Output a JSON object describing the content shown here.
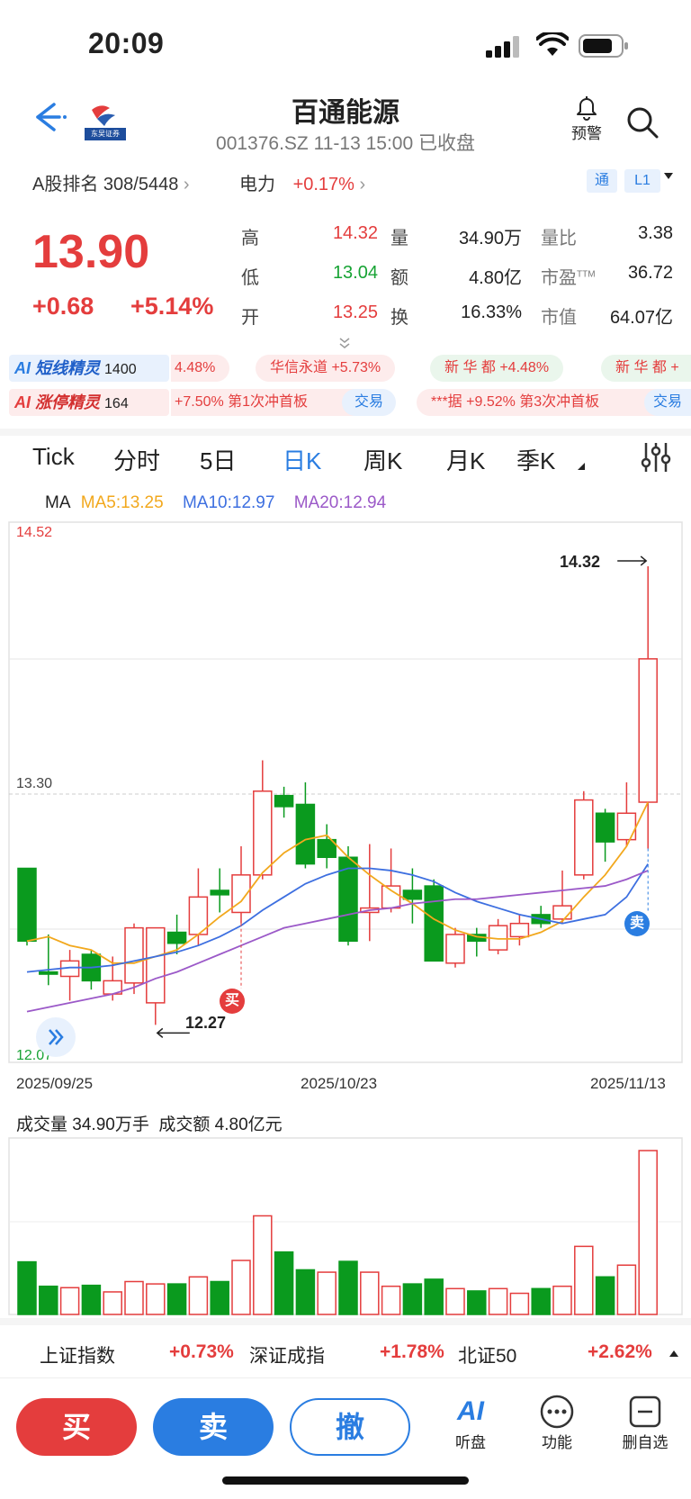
{
  "status_bar": {
    "time": "20:09"
  },
  "header": {
    "stock_name": "百通能源",
    "subtitle": "001376.SZ 11-13 15:00 已收盘",
    "logo_text": "东吴证券",
    "alert_label": "预警"
  },
  "rank": {
    "label": "A股排名 308/5448",
    "sector_name": "电力",
    "sector_change": "+0.17%",
    "tag1": "通",
    "tag2": "L1"
  },
  "quote": {
    "price": "13.90",
    "change": "+0.68",
    "change_pct": "+5.14%",
    "more_icon": "chevron-double-down-icon",
    "fields": [
      {
        "label": "高",
        "value": "14.32"
      },
      {
        "label": "低",
        "value": "13.04"
      },
      {
        "label": "开",
        "value": "13.25"
      },
      {
        "label": "量",
        "value": "34.90万"
      },
      {
        "label": "额",
        "value": "4.80亿"
      },
      {
        "label": "换",
        "value": "16.33%"
      },
      {
        "label": "量比",
        "value": "3.38"
      },
      {
        "label": "市盈",
        "sup": "TTM",
        "value": "36.72"
      },
      {
        "label": "市值",
        "value": "64.07亿"
      }
    ]
  },
  "ai": {
    "row1": {
      "badge_name": "短线精灵",
      "badge_count": "1400",
      "pills": [
        "4.48%",
        "华信永道 +5.73%",
        "新 华 都 +4.48%",
        "新 华 都 +"
      ]
    },
    "row2": {
      "badge_name": "涨停精灵",
      "badge_count": "164",
      "pills": [
        "+7.50% 第1次冲首板",
        "交易",
        "***据 +9.52% 第3次冲首板",
        "交易"
      ]
    }
  },
  "tabs": [
    "Tick",
    "分时",
    "5日",
    "日K",
    "周K",
    "月K",
    "季K"
  ],
  "active_tab": "日K",
  "ma": {
    "label": "MA",
    "ma5": "MA5:13.25",
    "ma10": "MA10:12.97",
    "ma20": "MA20:12.94"
  },
  "colors": {
    "up": "#e43d3d",
    "down": "#0a9a1e",
    "ma5": "#f2a81d",
    "ma10": "#3d6fe0",
    "ma20": "#9b59c8",
    "accent": "#2a7de1"
  },
  "chart_data": {
    "type": "candlestick",
    "y_top_label": "14.52",
    "y_mid_label": "13.30",
    "y_bottom_label": "12.07",
    "ylim": [
      12.07,
      14.52
    ],
    "x_labels": [
      "2025/09/25",
      "2025/10/23",
      "2025/11/13"
    ],
    "high_marker": "14.32",
    "low_marker": "12.27",
    "buy_marker": "买",
    "sell_marker": "卖",
    "candles": [
      {
        "o": 12.95,
        "c": 12.62,
        "h": 12.95,
        "l": 12.6
      },
      {
        "o": 12.48,
        "c": 12.47,
        "h": 12.65,
        "l": 12.42
      },
      {
        "o": 12.46,
        "c": 12.53,
        "h": 12.58,
        "l": 12.35
      },
      {
        "o": 12.56,
        "c": 12.44,
        "h": 12.58,
        "l": 12.4
      },
      {
        "o": 12.38,
        "c": 12.44,
        "h": 12.55,
        "l": 12.35
      },
      {
        "o": 12.43,
        "c": 12.68,
        "h": 12.7,
        "l": 12.38
      },
      {
        "o": 12.34,
        "c": 12.68,
        "h": 12.68,
        "l": 12.24
      },
      {
        "o": 12.66,
        "c": 12.61,
        "h": 12.74,
        "l": 12.56
      },
      {
        "o": 12.65,
        "c": 12.82,
        "h": 12.95,
        "l": 12.6
      },
      {
        "o": 12.85,
        "c": 12.83,
        "h": 12.95,
        "l": 12.75
      },
      {
        "o": 12.75,
        "c": 12.92,
        "h": 13.05,
        "l": 12.7
      },
      {
        "o": 12.92,
        "c": 13.3,
        "h": 13.44,
        "l": 12.9
      },
      {
        "o": 13.28,
        "c": 13.23,
        "h": 13.32,
        "l": 13.18
      },
      {
        "o": 13.24,
        "c": 12.97,
        "h": 13.34,
        "l": 12.95
      },
      {
        "o": 13.08,
        "c": 13.0,
        "h": 13.15,
        "l": 12.95
      },
      {
        "o": 13.0,
        "c": 12.62,
        "h": 13.05,
        "l": 12.6
      },
      {
        "o": 12.75,
        "c": 12.77,
        "h": 13.06,
        "l": 12.62
      },
      {
        "o": 12.77,
        "c": 12.87,
        "h": 13.04,
        "l": 12.75
      },
      {
        "o": 12.85,
        "c": 12.81,
        "h": 12.95,
        "l": 12.7
      },
      {
        "o": 12.87,
        "c": 12.53,
        "h": 12.9,
        "l": 12.53
      },
      {
        "o": 12.52,
        "c": 12.65,
        "h": 12.68,
        "l": 12.5
      },
      {
        "o": 12.65,
        "c": 12.62,
        "h": 12.68,
        "l": 12.55
      },
      {
        "o": 12.58,
        "c": 12.69,
        "h": 12.72,
        "l": 12.56
      },
      {
        "o": 12.64,
        "c": 12.7,
        "h": 12.74,
        "l": 12.6
      },
      {
        "o": 12.74,
        "c": 12.7,
        "h": 12.78,
        "l": 12.68
      },
      {
        "o": 12.72,
        "c": 12.78,
        "h": 12.94,
        "l": 12.7
      },
      {
        "o": 12.92,
        "c": 13.26,
        "h": 13.3,
        "l": 12.9
      },
      {
        "o": 13.2,
        "c": 13.07,
        "h": 13.22,
        "l": 12.98
      },
      {
        "o": 13.08,
        "c": 13.2,
        "h": 13.34,
        "l": 13.05
      },
      {
        "o": 13.25,
        "c": 13.9,
        "h": 14.32,
        "l": 13.04
      }
    ],
    "ma5": [
      12.62,
      12.64,
      12.6,
      12.58,
      12.52,
      12.52,
      12.55,
      12.58,
      12.65,
      12.73,
      12.8,
      12.93,
      13.02,
      13.08,
      13.1,
      13.0,
      12.92,
      12.85,
      12.79,
      12.72,
      12.67,
      12.64,
      12.63,
      12.63,
      12.66,
      12.71,
      12.82,
      12.92,
      13.05,
      13.25
    ],
    "ma10": [
      12.48,
      12.49,
      12.5,
      12.5,
      12.51,
      12.53,
      12.55,
      12.57,
      12.6,
      12.64,
      12.69,
      12.76,
      12.82,
      12.88,
      12.92,
      12.95,
      12.95,
      12.94,
      12.92,
      12.89,
      12.84,
      12.8,
      12.77,
      12.74,
      12.72,
      12.7,
      12.72,
      12.74,
      12.82,
      12.97
    ],
    "ma20": [
      12.3,
      12.32,
      12.34,
      12.36,
      12.38,
      12.41,
      12.45,
      12.48,
      12.52,
      12.56,
      12.6,
      12.64,
      12.68,
      12.7,
      12.72,
      12.74,
      12.76,
      12.77,
      12.79,
      12.8,
      12.81,
      12.81,
      12.82,
      12.83,
      12.84,
      12.85,
      12.86,
      12.87,
      12.9,
      12.94
    ]
  },
  "volume": {
    "title": "成交量 34.90万手  成交额 4.80亿元",
    "values": [
      11.2,
      6.0,
      5.7,
      6.2,
      4.8,
      7.0,
      6.5,
      6.5,
      8.0,
      7.0,
      11.5,
      21.0,
      13.3,
      9.5,
      9.0,
      11.3,
      9.0,
      6.0,
      6.5,
      7.5,
      5.5,
      5.0,
      5.5,
      4.5,
      5.5,
      6.0,
      14.5,
      8.0,
      10.5,
      34.9
    ],
    "up": [
      false,
      false,
      true,
      false,
      true,
      true,
      true,
      false,
      true,
      false,
      true,
      true,
      false,
      false,
      true,
      false,
      true,
      true,
      false,
      false,
      true,
      false,
      true,
      true,
      false,
      true,
      true,
      false,
      true,
      true
    ]
  },
  "index_bar": [
    {
      "name": "上证指数",
      "value": "+0.73%"
    },
    {
      "name": "深证成指",
      "value": "+1.78%"
    },
    {
      "name": "北证50",
      "value": "+2.62%"
    }
  ],
  "actions": {
    "buy": "买",
    "sell": "卖",
    "cancel": "撤",
    "ai_label": "听盘",
    "ai_icon_text": "AI",
    "func_label": "功能",
    "remove_label": "删自选"
  }
}
